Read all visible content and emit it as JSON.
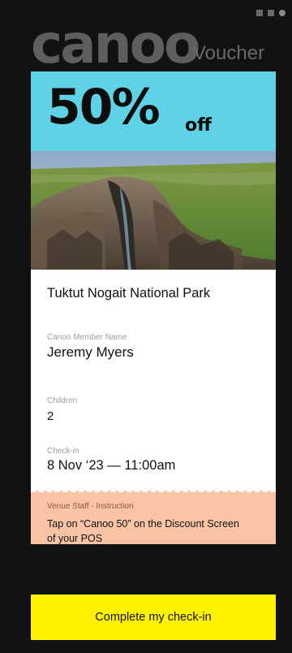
{
  "brand": {
    "logo_text": "canoo",
    "voucher_label": "Voucher"
  },
  "offer": {
    "value": "50%",
    "suffix": "off",
    "banner_color": "#5fd2e6"
  },
  "park": {
    "name": "Tuktut Nogait National Park"
  },
  "member": {
    "label": "Canoo Member Name",
    "value": "Jeremy Myers"
  },
  "children": {
    "label": "Children",
    "value": "2"
  },
  "checkin": {
    "label": "Check-in",
    "value": "8 Nov ‘23 — 11:00am"
  },
  "instructions": {
    "label": "Venue Staff - Instruction",
    "text": "Tap on “Canoo 50” on the Discount Screen of your POS",
    "color": "#f9c3a6"
  },
  "cta": {
    "label": "Complete my check-in",
    "color": "#fff200"
  },
  "icons": {
    "status": "status-dots-icon",
    "photo": "canyon-landscape-image"
  }
}
